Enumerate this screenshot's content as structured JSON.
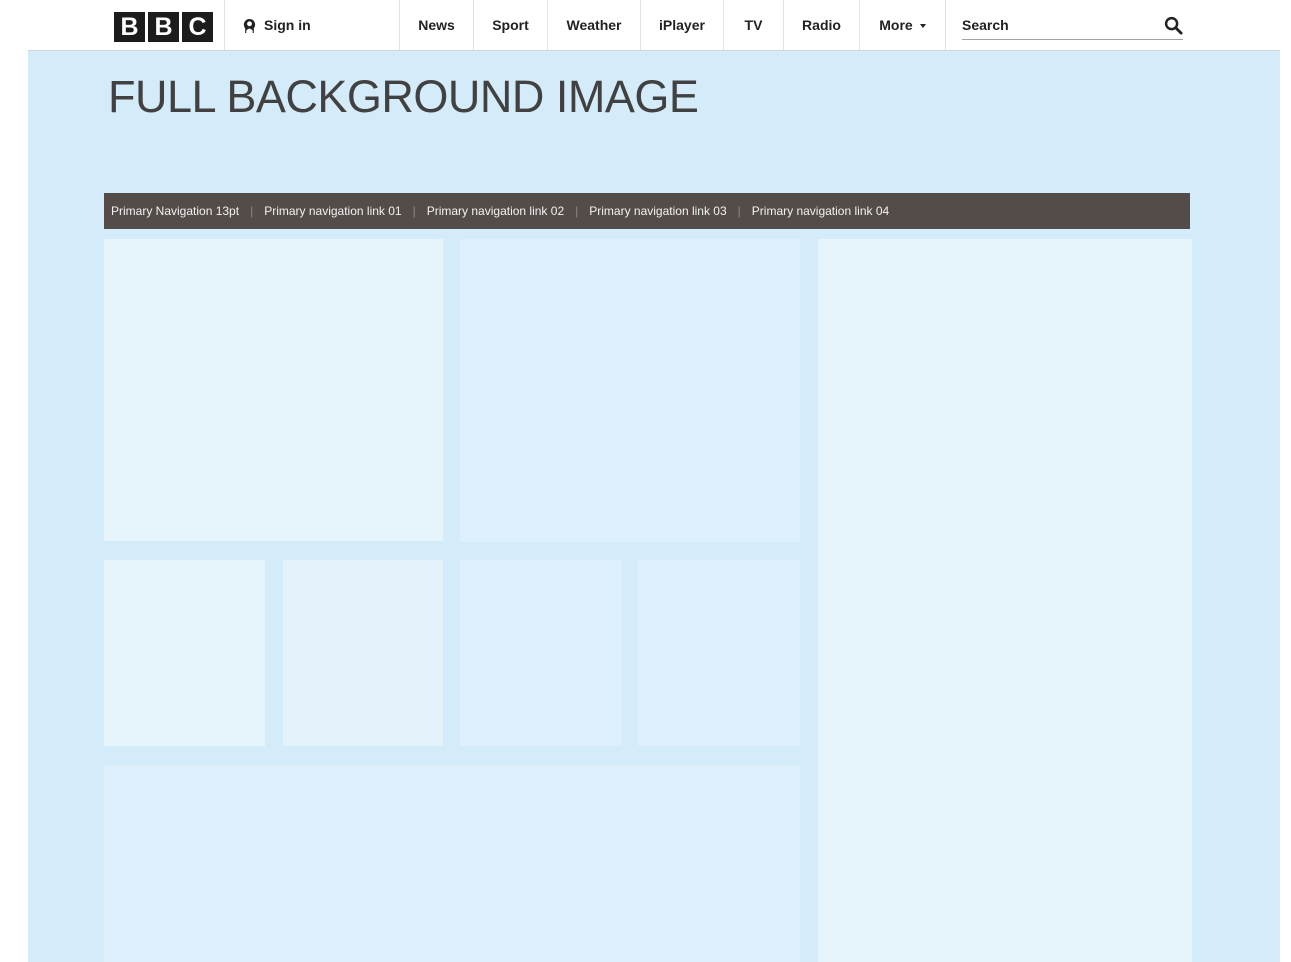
{
  "header": {
    "logo_letters": [
      "B",
      "B",
      "C"
    ],
    "sign_in_label": "Sign in",
    "nav_items": [
      {
        "label": "News"
      },
      {
        "label": "Sport"
      },
      {
        "label": "Weather"
      },
      {
        "label": "iPlayer"
      },
      {
        "label": "TV"
      },
      {
        "label": "Radio"
      },
      {
        "label": "More"
      }
    ],
    "search_label": "Search",
    "icons": {
      "signin": "user-icon",
      "more": "caret-down-icon",
      "search": "search-icon"
    }
  },
  "hero": {
    "title": "FULL BACKGROUND IMAGE"
  },
  "primary_nav": {
    "items": [
      {
        "label": "Primary Navigation 13pt"
      },
      {
        "label": "Primary navigation link 01"
      },
      {
        "label": "Primary navigation link 02"
      },
      {
        "label": "Primary navigation link 03"
      },
      {
        "label": "Primary navigation link 04"
      }
    ]
  },
  "colors": {
    "background": "#d4ebf9",
    "primary_nav_bg": "#544c48",
    "tile_light": "#e6f4fb",
    "tile_mid": "#ddeffa",
    "text_dark": "#414141"
  }
}
